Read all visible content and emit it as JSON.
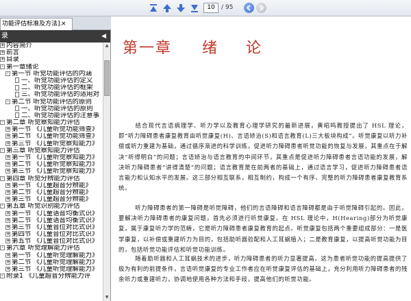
{
  "toolbar": {
    "buttons": [
      "first-page-icon",
      "prev-page-icon",
      "next-page-icon",
      "last-page-icon"
    ],
    "page_current": "10",
    "page_total": "/ 95",
    "nav_buttons": [
      "back-icon",
      "forward-icon"
    ],
    "accent": "#3b6fd1"
  },
  "tabs": [
    {
      "label": "功能评估标准及方法].",
      "close": "×"
    }
  ],
  "sidebar": {
    "header": "录",
    "collapse": "◀",
    "items": [
      {
        "toggle": "+",
        "label": "内容简介"
      },
      {
        "toggle": "+",
        "label": "前言"
      },
      {
        "toggle": "+",
        "label": "目录"
      },
      {
        "toggle": "-",
        "label": "第一章绪论"
      },
      {
        "toggle": "-",
        "label": "第一节  听觉功能评估的内涵"
      },
      {
        "doc": true,
        "label": "一、听觉功能评估的定义"
      },
      {
        "doc": true,
        "label": "二、听觉功能评估的框架"
      },
      {
        "doc": true,
        "label": "三、听觉功能评估的适用对"
      },
      {
        "toggle": "-",
        "label": "第二节  听觉功能评估的原则"
      },
      {
        "doc": true,
        "label": "一、听觉功能评估的原则"
      },
      {
        "doc": true,
        "label": "二、听觉功能评估的注意事"
      },
      {
        "toggle": "-",
        "label": "第二章  听觉察知能力评估"
      },
      {
        "toggle": "+",
        "label": "第一节  《儿童听觉功能筛查》"
      },
      {
        "toggle": "+",
        "label": "第二节  《儿童听觉功能筛查》"
      },
      {
        "toggle": "+",
        "label": "第三节  《儿童听觉察知能力》"
      },
      {
        "toggle": "-",
        "label": "第三章  听觉察知能力评估"
      },
      {
        "toggle": "+",
        "label": "第一节  《儿童听觉察知能力》"
      },
      {
        "toggle": "+",
        "label": "第二节  《儿童听觉察知能力》"
      },
      {
        "toggle": "+",
        "label": "第三节  《儿童听觉察知能力》"
      },
      {
        "toggle": "-",
        "label": "第四章  听觉分辨能力评估"
      },
      {
        "toggle": "+",
        "label": "第一节  《儿童超音分辨能》"
      },
      {
        "toggle": "+",
        "label": "第二节  《儿童超音分辨能》"
      },
      {
        "toggle": "+",
        "label": "第三节  《儿童超音分辨能》"
      },
      {
        "toggle": "-",
        "label": "第五章  听觉识别能力评估"
      },
      {
        "toggle": "+",
        "label": "第一节  《儿童语音均衡式识》"
      },
      {
        "toggle": "+",
        "label": "第二节  《儿童语音均衡式识》"
      },
      {
        "toggle": "+",
        "label": "第三节  《儿童音位对比式识》"
      },
      {
        "toggle": "+",
        "label": "第四节  《儿童音位对比式识》"
      },
      {
        "toggle": "+",
        "label": "第五节  《儿童音位对比式识》"
      },
      {
        "toggle": "-",
        "label": "第六章  听觉理解能力评估"
      },
      {
        "toggle": "+",
        "label": "第一节  《儿童听觉理解能力》"
      },
      {
        "toggle": "+",
        "label": "第二节  《儿童听觉理解能力》"
      },
      {
        "toggle": "+",
        "label": "第三节  《儿童听觉理解能力》"
      },
      {
        "toggle": "-",
        "label": "附录1  《儿童超音分辨能力评"
      }
    ]
  },
  "document": {
    "chapter_num": "第一章",
    "chapter_title_1": "绪",
    "chapter_title_2": "论",
    "title_color": "#c0392b",
    "para1": "结合现代言语病理学、听力学以及教育心理学研究的最新进展，黄昭鸣教授提出了 HSL 理论，即“听力障碍患者康复教育由听觉康复(H)、言语矫治(S)和语言教育(L)三大板块构成”。听觉康复以听力补偿或听力重建为基础，通过循序渐进的科学训练，促进听力障碍患者听觉功能的恢复与发展，其重点在于解决“听得明白”的问题；言语矫治与语言教育的中间环节，其重点是促进听力障碍患者言语功能的发展，解决听力障碍患者“讲得清楚”的问题；语言教育是在前两者的基础上，通过语言学习，促进听力障碍患者语言能力和认知水平的发展。这三部分相互联系，相互制约，构成一个有序、完整的听力障碍患者康复教育系统。",
    "para2": "听力障碍患者的第一障碍是听觉障碍，他们的言语障碍和语言障碍都是由于听觉障碍引起的。因此，要解决听力障碍患者的康复问题，首先必须进行听觉康复。在 HSL 理论中，H(Hearing)部分为听觉康复，属于康复听力学的范畴，它是听力障碍患者康复教育的起点。听觉康复包括两个重要组成部分：一是医学康复，以补偿或重建听力为目的，包括助听器验配和人工耳蜗植入；二是教育康复，以提高听觉功能为目的，包括听觉功能评估和听觉功能训练。",
    "para3": "随着助听器和人工耳蜗技术的进步，听力障碍患者的听力显著提高。这为患者听觉功能的提高提供了极为有利的前提条件，言语听觉康复的专业工作者应在听觉康复评估的基础上，充分利用听力障碍患者的残余听力或重建听力，协调地使用各种方法和手段，提高他们的听觉功能。"
  }
}
